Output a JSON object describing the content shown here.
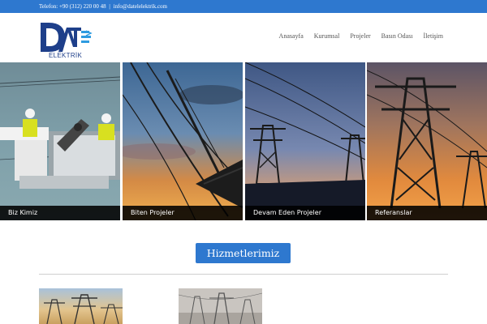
{
  "topbar": {
    "phone": "Telefon: +90 (312) 220 00 48",
    "separator": "|",
    "email": "info@datelelektrik.com"
  },
  "header": {
    "logo_text": "DATEL",
    "logo_sub": "ELEKTRİK",
    "nav": [
      "Anasayfa",
      "Kurumsal",
      "Projeler",
      "Basın Odası",
      "İletişim"
    ]
  },
  "tiles": [
    {
      "label": "Biz Kimiz"
    },
    {
      "label": "Biten Projeler"
    },
    {
      "label": "Devam Eden Projeler"
    },
    {
      "label": "Referanslar"
    }
  ],
  "services": {
    "title": "Hizmetlerimiz"
  },
  "colors": {
    "accent": "#2e78cf",
    "logo_blue": "#1e3f8a",
    "caption_bg": "#000000"
  }
}
